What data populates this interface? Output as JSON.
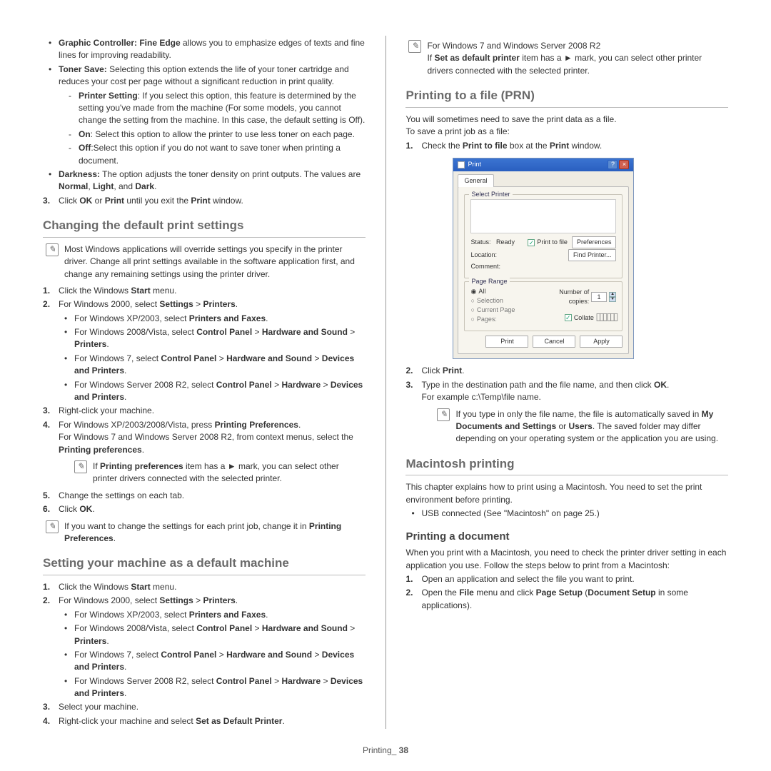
{
  "footer": {
    "section": "Printing_",
    "page": "38"
  },
  "left": {
    "features": [
      {
        "bold": "Graphic Controller: Fine Edge",
        "rest": " allows you to emphasize edges of texts and fine lines for improving readability."
      },
      {
        "bold": "Toner Save:",
        "rest": "  Selecting this option extends the life of your toner cartridge and reduces your cost per page without a significant reduction in print quality."
      }
    ],
    "toner_sub": [
      {
        "bold": "Printer Setting",
        "rest": ": If you select this option, this feature is determined by the setting you've made from the machine (For some models, you cannot change the setting from the machine. In this case, the default setting is Off)."
      },
      {
        "bold": "On",
        "rest": ": Select this option to allow the printer to use less toner on each page."
      },
      {
        "bold": "Off",
        "rest": ":Select this option if you do not want to save toner when printing a document."
      }
    ],
    "darkness": {
      "bold": "Darkness:",
      "rest": "  The option adjusts the toner density on print outputs. The values are ",
      "b2": "Normal",
      "s2": ", ",
      "b3": "Light",
      "s3": ", and ",
      "b4": "Dark",
      "s4": "."
    },
    "step3": {
      "pre": "Click ",
      "b1": "OK",
      "mid": " or ",
      "b2": "Print",
      "mid2": " until you exit the ",
      "b3": "Print",
      "end": " window."
    },
    "h_changing": "Changing the default print settings",
    "note_changing": "Most Windows applications will override settings you specify in the printer driver. Change all print settings available in the software application first, and change any remaining settings using the printer driver.",
    "ch_steps": {
      "s1": {
        "pre": "Click the Windows ",
        "b": "Start",
        "end": " menu."
      },
      "s2": {
        "pre": "For Windows 2000, select ",
        "b1": "Settings",
        "mid": " > ",
        "b2": "Printers",
        "end": "."
      },
      "s2_sub": [
        {
          "text": "For Windows XP/2003, select ",
          "b": "Printers and Faxes",
          "end": "."
        },
        {
          "text": "For Windows 2008/Vista, select ",
          "b1": "Control Panel",
          "mid": " > ",
          "b2": "Hardware and Sound",
          "mid2": " > ",
          "b3": "Printers",
          "end": "."
        },
        {
          "text": "For Windows 7, select ",
          "b1": "Control Panel",
          "mid": " > ",
          "b2": "Hardware and Sound",
          "mid2": " > ",
          "b3": "Devices and Printers",
          "end": "."
        },
        {
          "text": "For Windows Server 2008 R2, select ",
          "b1": "Control Panel",
          "mid": " > ",
          "b2": "Hardware",
          "mid2": " > ",
          "b3": "Devices and Printers",
          "end": "."
        }
      ],
      "s3": "Right-click your machine.",
      "s4": {
        "line1pre": "For Windows XP/2003/2008/Vista, press ",
        "line1b": "Printing Preferences",
        "line1end": ".",
        "line2pre": "For Windows 7 and Windows Server 2008 R2, from context menus, select the ",
        "line2b": "Printing preferences",
        "line2end": "."
      },
      "s4_note": {
        "pre": "If ",
        "b1": "Printing preferences",
        "mid": " item has a ► mark, you can select other printer drivers connected with the selected printer."
      },
      "s5": "Change the settings on each tab.",
      "s6": {
        "pre": "Click ",
        "b": "OK",
        "end": "."
      },
      "n6": {
        "pre": "If you want to change the settings for each print job, change it in ",
        "b": "Printing Preferences",
        "end": "."
      }
    },
    "h_setting": "Setting your machine as a default machine",
    "set_steps": {
      "s1": {
        "pre": "Click the Windows ",
        "b": "Start",
        "end": " menu."
      },
      "s2": {
        "pre": "For Windows 2000, select ",
        "b1": "Settings",
        "mid": " > ",
        "b2": "Printers",
        "end": "."
      },
      "s2_sub": [
        {
          "text": "For Windows XP/2003, select ",
          "b": "Printers and Faxes",
          "end": "."
        },
        {
          "text": "For Windows 2008/Vista, select ",
          "b1": "Control Panel",
          "mid": " > ",
          "b2": "Hardware and Sound",
          "mid2": " > ",
          "b3": "Printers",
          "end": "."
        },
        {
          "text": "For Windows 7, select ",
          "b1": "Control Panel",
          "mid": " > ",
          "b2": "Hardware and Sound",
          "mid2": " > ",
          "b3": "Devices and Printers",
          "end": "."
        },
        {
          "text": "For Windows Server 2008 R2, select ",
          "b1": "Control Panel",
          "mid": " > ",
          "b2": "Hardware",
          "mid2": " > ",
          "b3": "Devices and Printers",
          "end": "."
        }
      ],
      "s3": "Select your machine.",
      "s4": {
        "pre": "Right-click your machine and select ",
        "b": "Set as Default Printer",
        "end": "."
      }
    }
  },
  "right": {
    "top_note": {
      "line1": "For Windows 7 and Windows Server 2008 R2",
      "line2pre": "If ",
      "line2b": "Set as default printer",
      "line2mid": " item has a ► mark, you can select other printer drivers connected with the selected printer."
    },
    "h_prn": "Printing to a file (PRN)",
    "prn_intro1": "You will sometimes need to save the print data as a file.",
    "prn_intro2": "To save a print job as a file:",
    "prn_s1": {
      "pre": "Check the ",
      "b1": "Print to file",
      "mid": " box at the ",
      "b2": "Print",
      "end": " window."
    },
    "dlg": {
      "title": "Print",
      "tab": "General",
      "grp_printer": "Select Printer",
      "status_lbl": "Status:",
      "status_val": "Ready",
      "location_lbl": "Location:",
      "comment_lbl": "Comment:",
      "print_to_file": "Print to file",
      "preferences": "Preferences",
      "find_printer": "Find Printer...",
      "grp_range": "Page Range",
      "r_all": "All",
      "r_selection": "Selection",
      "r_current": "Current Page",
      "r_pages": "Pages:",
      "copies_lbl": "Number of copies:",
      "copies_val": "1",
      "collate": "Collate",
      "btn_print": "Print",
      "btn_cancel": "Cancel",
      "btn_apply": "Apply"
    },
    "prn_s2": {
      "pre": "Click ",
      "b": "Print",
      "end": "."
    },
    "prn_s3": {
      "line1pre": "Type in the destination path and the file name, and then click ",
      "line1b": "OK",
      "line1end": ".",
      "line2": "For example c:\\Temp\\file name."
    },
    "prn_note": {
      "pre": "If you type in only the file name, the file is automatically saved in ",
      "b1": "My Documents and Settings",
      "mid": " or ",
      "b2": "Users",
      "end": ". The saved folder may differ depending on your operating system or the application you are using."
    },
    "h_mac": "Macintosh printing",
    "mac_intro": "This chapter explains how to print using a Macintosh. You need to set the print environment before printing.",
    "mac_bullet": "USB connected (See \"Macintosh\" on page 25.)",
    "h_printdoc": "Printing a document",
    "printdoc_intro": "When you print with a Macintosh, you need to check the printer driver setting in each application you use. Follow the steps below to print from a Macintosh:",
    "printdoc_s1": "Open an application and select the file you want to print.",
    "printdoc_s2": {
      "pre": "Open the ",
      "b1": "File",
      "mid": " menu and click ",
      "b2": "Page Setup",
      "mid2": " (",
      "b3": "Document Setup",
      "end": " in some applications)."
    }
  }
}
